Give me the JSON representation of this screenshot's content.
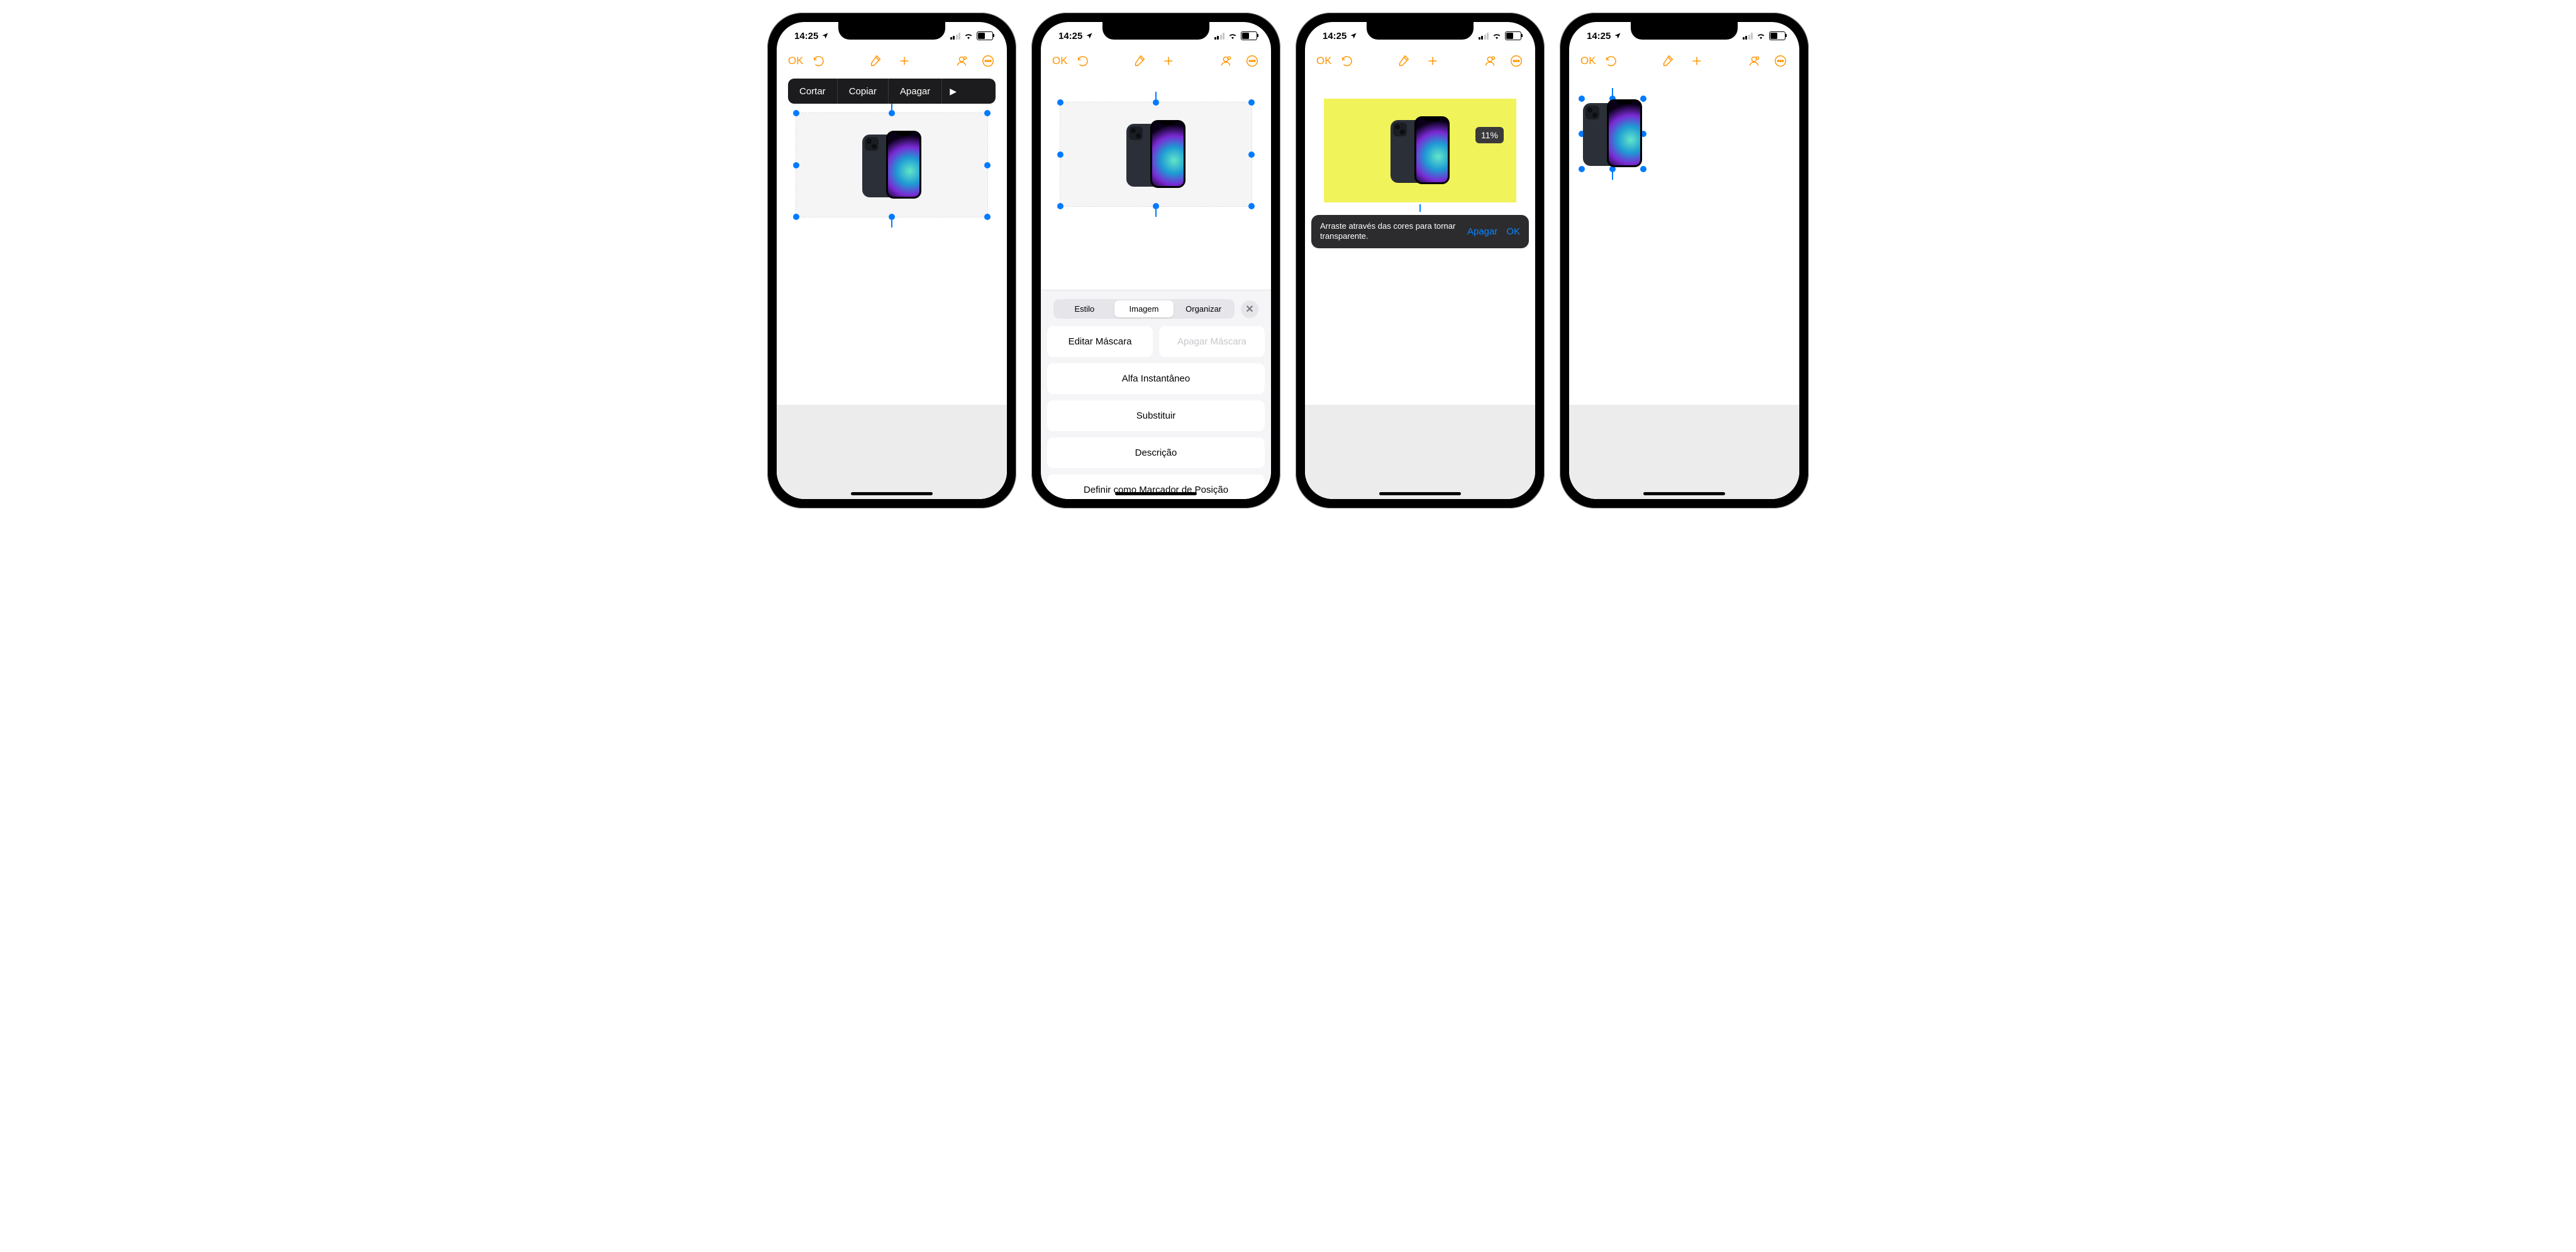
{
  "status": {
    "time": "14:25"
  },
  "toolbar": {
    "ok": "OK"
  },
  "context_menu": {
    "items": [
      "Cortar",
      "Copiar",
      "Apagar"
    ]
  },
  "sheet": {
    "segments": {
      "style": "Estilo",
      "image": "Imagem",
      "arrange": "Organizar"
    },
    "edit_mask": "Editar Máscara",
    "clear_mask": "Apagar Máscara",
    "instant_alpha": "Alfa Instantâneo",
    "replace": "Substituir",
    "description": "Descrição",
    "define_placeholder": "Definir como Marcador de Posição"
  },
  "alpha": {
    "percent": "11%",
    "hint": "Arraste através das cores para tornar transparente.",
    "clear": "Apagar",
    "ok": "OK"
  }
}
